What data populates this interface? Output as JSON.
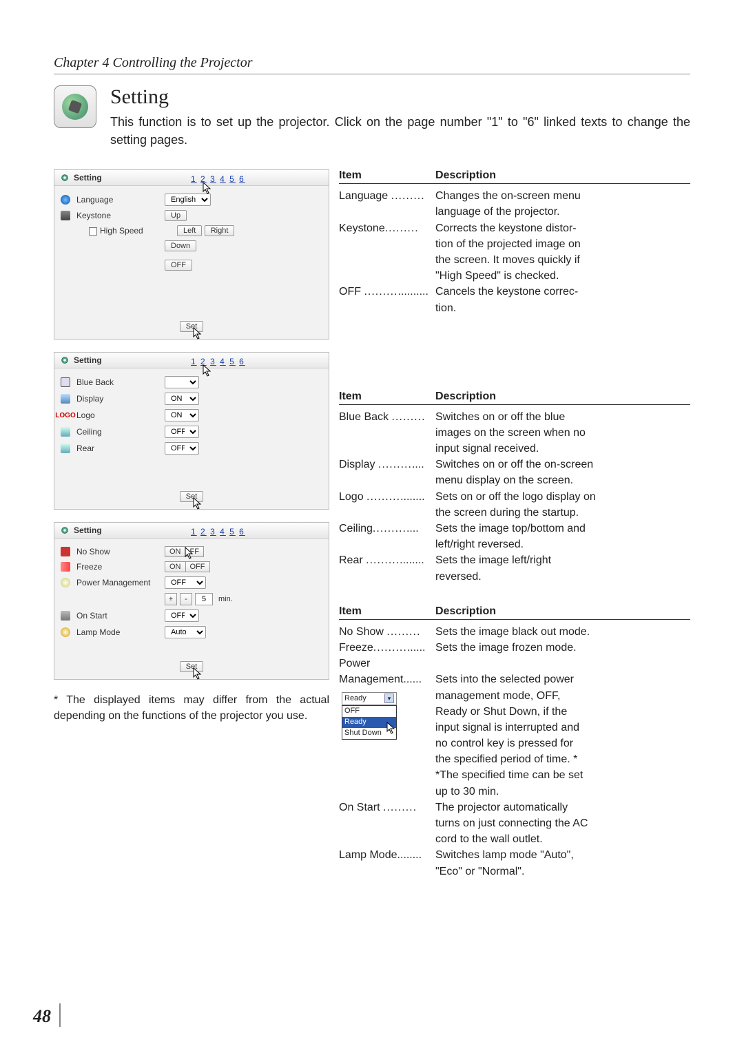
{
  "chapter": "Chapter 4 Controlling the Projector",
  "heading": "Setting",
  "intro": "This function is to set up the projector. Click on the page number \"1\" to \"6\" linked texts to change the setting pages.",
  "page_links": [
    "1",
    "2",
    "3",
    "4",
    "5",
    "6"
  ],
  "panel1": {
    "title": "Setting",
    "rows": {
      "language": {
        "label": "Language",
        "value": "English"
      },
      "keystone": {
        "label": "Keystone",
        "buttons": {
          "up": "Up",
          "left": "Left",
          "right": "Right",
          "down": "Down",
          "off": "OFF"
        }
      },
      "highspeed": {
        "label": "High Speed"
      }
    },
    "set": "Set"
  },
  "panel2": {
    "title": "Setting",
    "rows": {
      "blueback": {
        "label": "Blue Back",
        "value": ""
      },
      "display": {
        "label": "Display",
        "value": "ON"
      },
      "logo": {
        "label": "Logo",
        "value": "ON",
        "prefix": "LOGO"
      },
      "ceiling": {
        "label": "Ceiling",
        "value": "OFF"
      },
      "rear": {
        "label": "Rear",
        "value": "OFF"
      }
    },
    "set": "Set"
  },
  "panel3": {
    "title": "Setting",
    "rows": {
      "noshow": {
        "label": "No Show",
        "on": "ON",
        "off": "FF"
      },
      "freeze": {
        "label": "Freeze",
        "on": "ON",
        "off": "OFF"
      },
      "powermgmt": {
        "label": "Power Management",
        "value": "OFF",
        "minutes": "5",
        "unit": "min.",
        "plus": "+",
        "minus": "-"
      },
      "onstart": {
        "label": "On Start",
        "value": "OFF"
      },
      "lampmode": {
        "label": "Lamp Mode",
        "value": "Auto"
      }
    },
    "set": "Set"
  },
  "tables": {
    "head_item": "Item",
    "head_desc": "Description",
    "t1": [
      {
        "item": "Language",
        "desc_l1": "Changes the on-screen menu",
        "desc_l2": "language of the projector."
      },
      {
        "item": "Keystone",
        "desc_l1": "Corrects the keystone distor-",
        "desc_l2": "tion of the projected image on",
        "desc_l3": "the screen. It moves quickly if",
        "desc_l4": "\"High Speed\" is checked."
      },
      {
        "item": "OFF",
        "desc_l1": "Cancels the keystone correc-",
        "desc_l2": "tion."
      }
    ],
    "t2": [
      {
        "item": "Blue Back",
        "desc_l1": "Switches on or off the blue",
        "desc_l2": "images on the screen when no",
        "desc_l3": "input signal received."
      },
      {
        "item": "Display",
        "desc_l1": "Switches on or off the on-screen",
        "desc_l2": "menu display on the screen."
      },
      {
        "item": "Logo",
        "desc_l1": "Sets on or off the logo display on",
        "desc_l2": "the screen during the startup."
      },
      {
        "item": "Ceiling",
        "desc_l1": "Sets the image top/bottom and",
        "desc_l2": "left/right reversed."
      },
      {
        "item": "Rear",
        "desc_l1": "Sets the image left/right",
        "desc_l2": "reversed."
      }
    ],
    "t3": [
      {
        "item": "No Show",
        "desc_l1": "Sets the image black out mode."
      },
      {
        "item": "Freeze",
        "desc_l1": "Sets the image frozen mode."
      },
      {
        "item": "Power",
        "noitemline": true
      },
      {
        "item": "Management",
        "desc_l1": "Sets into the selected power",
        "desc_l2": "management mode, OFF,",
        "desc_l3": "Ready or Shut Down, if the",
        "desc_l4": "input signal is interrupted and",
        "desc_l5": "no control key is pressed for",
        "desc_l6": "the specified period of time. *",
        "desc_l7": "*The specified time can be set",
        "desc_l8": "up to 30 min."
      },
      {
        "item": "On Start",
        "desc_l1": "The projector automatically",
        "desc_l2": "turns on just connecting the AC",
        "desc_l3": "cord to the wall outlet."
      },
      {
        "item": "Lamp Mode",
        "desc_l1": "Switches lamp mode \"Auto\",",
        "desc_l2": "\"Eco\" or \"Normal\"."
      }
    ],
    "dropdown": {
      "top": "Ready",
      "opts": [
        "OFF",
        "Ready",
        "Shut Down"
      ],
      "selected": "Ready"
    }
  },
  "footnote": "* The displayed items may differ from the actual depending on the functions of the projector you use.",
  "page_number": "48"
}
